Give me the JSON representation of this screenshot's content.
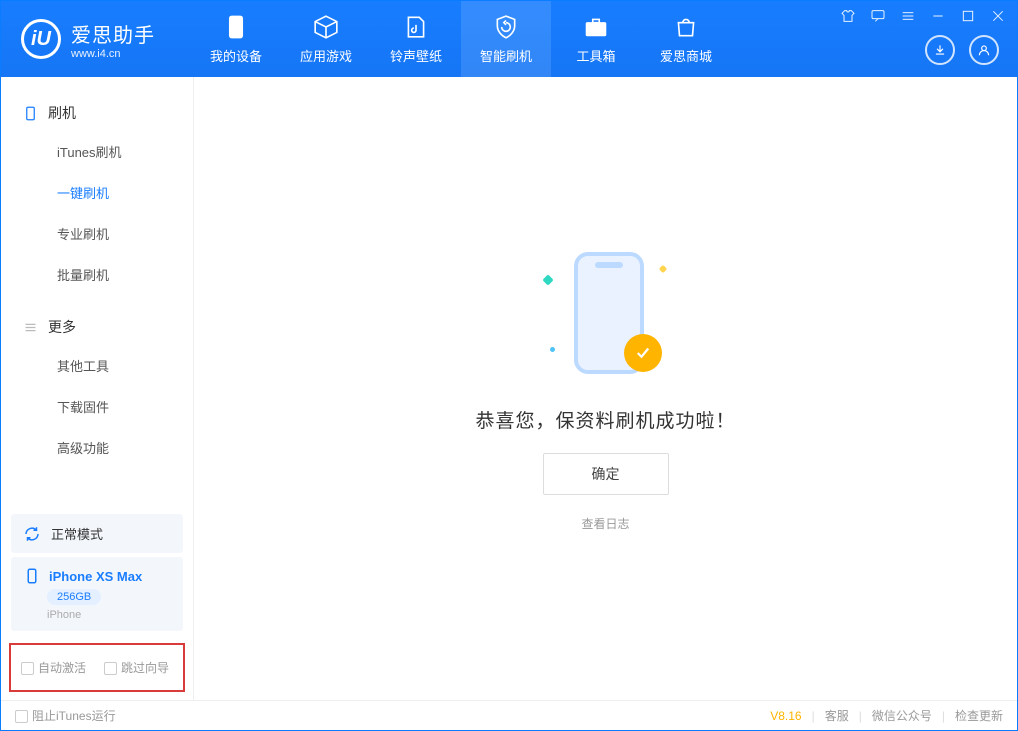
{
  "app": {
    "logo_letter": "iU",
    "name": "爱思助手",
    "site": "www.i4.cn"
  },
  "tabs": {
    "device": "我的设备",
    "apps": "应用游戏",
    "ringtones": "铃声壁纸",
    "flash": "智能刷机",
    "toolbox": "工具箱",
    "store": "爱思商城"
  },
  "sidebar": {
    "group1": "刷机",
    "items1": {
      "itunes": "iTunes刷机",
      "oneclick": "一键刷机",
      "pro": "专业刷机",
      "batch": "批量刷机"
    },
    "group2": "更多",
    "items2": {
      "other": "其他工具",
      "firmware": "下载固件",
      "advanced": "高级功能"
    }
  },
  "device": {
    "mode": "正常模式",
    "name": "iPhone XS Max",
    "storage": "256GB",
    "type": "iPhone"
  },
  "options": {
    "auto_activate": "自动激活",
    "skip_guide": "跳过向导"
  },
  "main": {
    "success_msg": "恭喜您，保资料刷机成功啦！",
    "ok_btn": "确定",
    "view_log": "查看日志"
  },
  "footer": {
    "block_itunes": "阻止iTunes运行",
    "version": "V8.16",
    "support": "客服",
    "wechat": "微信公众号",
    "update": "检查更新"
  }
}
